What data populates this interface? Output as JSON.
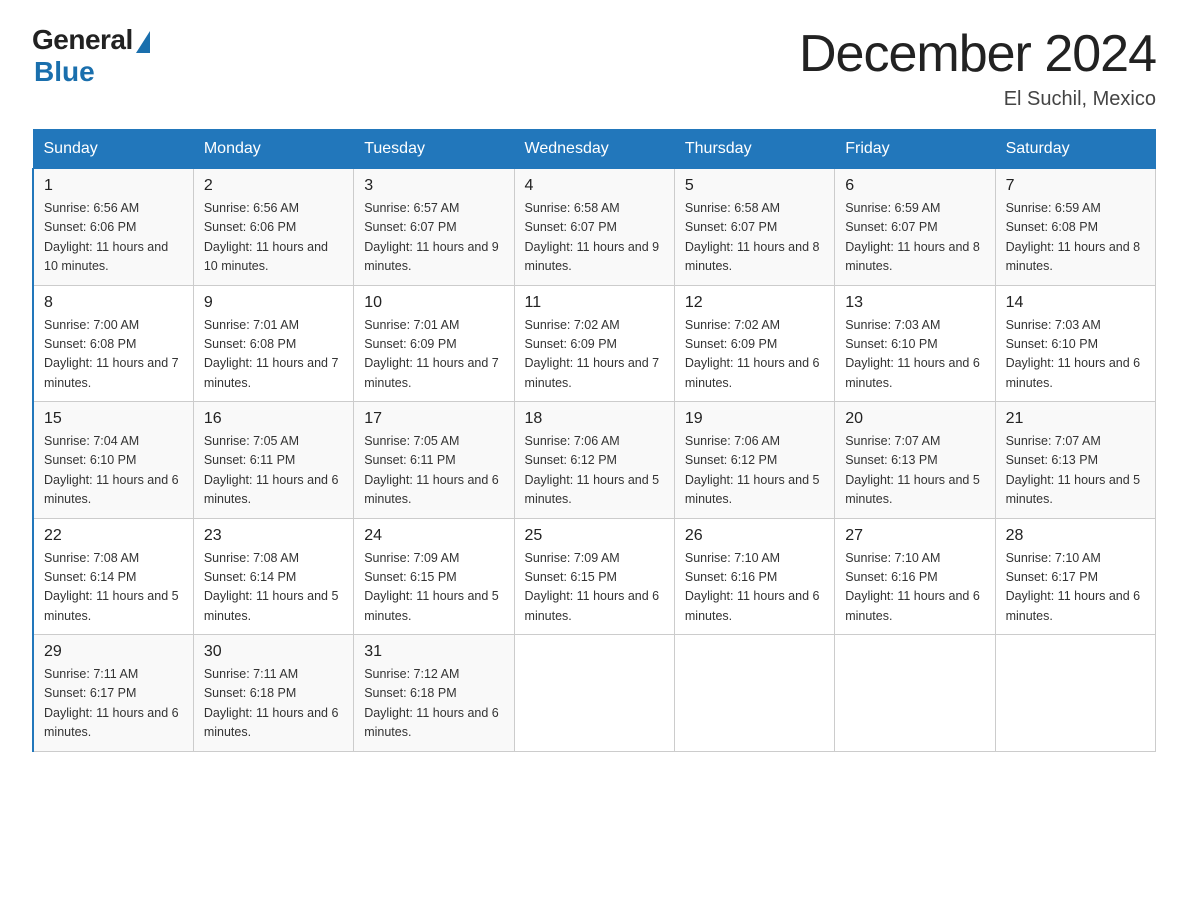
{
  "logo": {
    "general": "General",
    "blue": "Blue"
  },
  "title": "December 2024",
  "location": "El Suchil, Mexico",
  "days_of_week": [
    "Sunday",
    "Monday",
    "Tuesday",
    "Wednesday",
    "Thursday",
    "Friday",
    "Saturday"
  ],
  "weeks": [
    [
      {
        "day": "1",
        "sunrise": "6:56 AM",
        "sunset": "6:06 PM",
        "daylight": "11 hours and 10 minutes."
      },
      {
        "day": "2",
        "sunrise": "6:56 AM",
        "sunset": "6:06 PM",
        "daylight": "11 hours and 10 minutes."
      },
      {
        "day": "3",
        "sunrise": "6:57 AM",
        "sunset": "6:07 PM",
        "daylight": "11 hours and 9 minutes."
      },
      {
        "day": "4",
        "sunrise": "6:58 AM",
        "sunset": "6:07 PM",
        "daylight": "11 hours and 9 minutes."
      },
      {
        "day": "5",
        "sunrise": "6:58 AM",
        "sunset": "6:07 PM",
        "daylight": "11 hours and 8 minutes."
      },
      {
        "day": "6",
        "sunrise": "6:59 AM",
        "sunset": "6:07 PM",
        "daylight": "11 hours and 8 minutes."
      },
      {
        "day": "7",
        "sunrise": "6:59 AM",
        "sunset": "6:08 PM",
        "daylight": "11 hours and 8 minutes."
      }
    ],
    [
      {
        "day": "8",
        "sunrise": "7:00 AM",
        "sunset": "6:08 PM",
        "daylight": "11 hours and 7 minutes."
      },
      {
        "day": "9",
        "sunrise": "7:01 AM",
        "sunset": "6:08 PM",
        "daylight": "11 hours and 7 minutes."
      },
      {
        "day": "10",
        "sunrise": "7:01 AM",
        "sunset": "6:09 PM",
        "daylight": "11 hours and 7 minutes."
      },
      {
        "day": "11",
        "sunrise": "7:02 AM",
        "sunset": "6:09 PM",
        "daylight": "11 hours and 7 minutes."
      },
      {
        "day": "12",
        "sunrise": "7:02 AM",
        "sunset": "6:09 PM",
        "daylight": "11 hours and 6 minutes."
      },
      {
        "day": "13",
        "sunrise": "7:03 AM",
        "sunset": "6:10 PM",
        "daylight": "11 hours and 6 minutes."
      },
      {
        "day": "14",
        "sunrise": "7:03 AM",
        "sunset": "6:10 PM",
        "daylight": "11 hours and 6 minutes."
      }
    ],
    [
      {
        "day": "15",
        "sunrise": "7:04 AM",
        "sunset": "6:10 PM",
        "daylight": "11 hours and 6 minutes."
      },
      {
        "day": "16",
        "sunrise": "7:05 AM",
        "sunset": "6:11 PM",
        "daylight": "11 hours and 6 minutes."
      },
      {
        "day": "17",
        "sunrise": "7:05 AM",
        "sunset": "6:11 PM",
        "daylight": "11 hours and 6 minutes."
      },
      {
        "day": "18",
        "sunrise": "7:06 AM",
        "sunset": "6:12 PM",
        "daylight": "11 hours and 5 minutes."
      },
      {
        "day": "19",
        "sunrise": "7:06 AM",
        "sunset": "6:12 PM",
        "daylight": "11 hours and 5 minutes."
      },
      {
        "day": "20",
        "sunrise": "7:07 AM",
        "sunset": "6:13 PM",
        "daylight": "11 hours and 5 minutes."
      },
      {
        "day": "21",
        "sunrise": "7:07 AM",
        "sunset": "6:13 PM",
        "daylight": "11 hours and 5 minutes."
      }
    ],
    [
      {
        "day": "22",
        "sunrise": "7:08 AM",
        "sunset": "6:14 PM",
        "daylight": "11 hours and 5 minutes."
      },
      {
        "day": "23",
        "sunrise": "7:08 AM",
        "sunset": "6:14 PM",
        "daylight": "11 hours and 5 minutes."
      },
      {
        "day": "24",
        "sunrise": "7:09 AM",
        "sunset": "6:15 PM",
        "daylight": "11 hours and 5 minutes."
      },
      {
        "day": "25",
        "sunrise": "7:09 AM",
        "sunset": "6:15 PM",
        "daylight": "11 hours and 6 minutes."
      },
      {
        "day": "26",
        "sunrise": "7:10 AM",
        "sunset": "6:16 PM",
        "daylight": "11 hours and 6 minutes."
      },
      {
        "day": "27",
        "sunrise": "7:10 AM",
        "sunset": "6:16 PM",
        "daylight": "11 hours and 6 minutes."
      },
      {
        "day": "28",
        "sunrise": "7:10 AM",
        "sunset": "6:17 PM",
        "daylight": "11 hours and 6 minutes."
      }
    ],
    [
      {
        "day": "29",
        "sunrise": "7:11 AM",
        "sunset": "6:17 PM",
        "daylight": "11 hours and 6 minutes."
      },
      {
        "day": "30",
        "sunrise": "7:11 AM",
        "sunset": "6:18 PM",
        "daylight": "11 hours and 6 minutes."
      },
      {
        "day": "31",
        "sunrise": "7:12 AM",
        "sunset": "6:18 PM",
        "daylight": "11 hours and 6 minutes."
      },
      null,
      null,
      null,
      null
    ]
  ]
}
